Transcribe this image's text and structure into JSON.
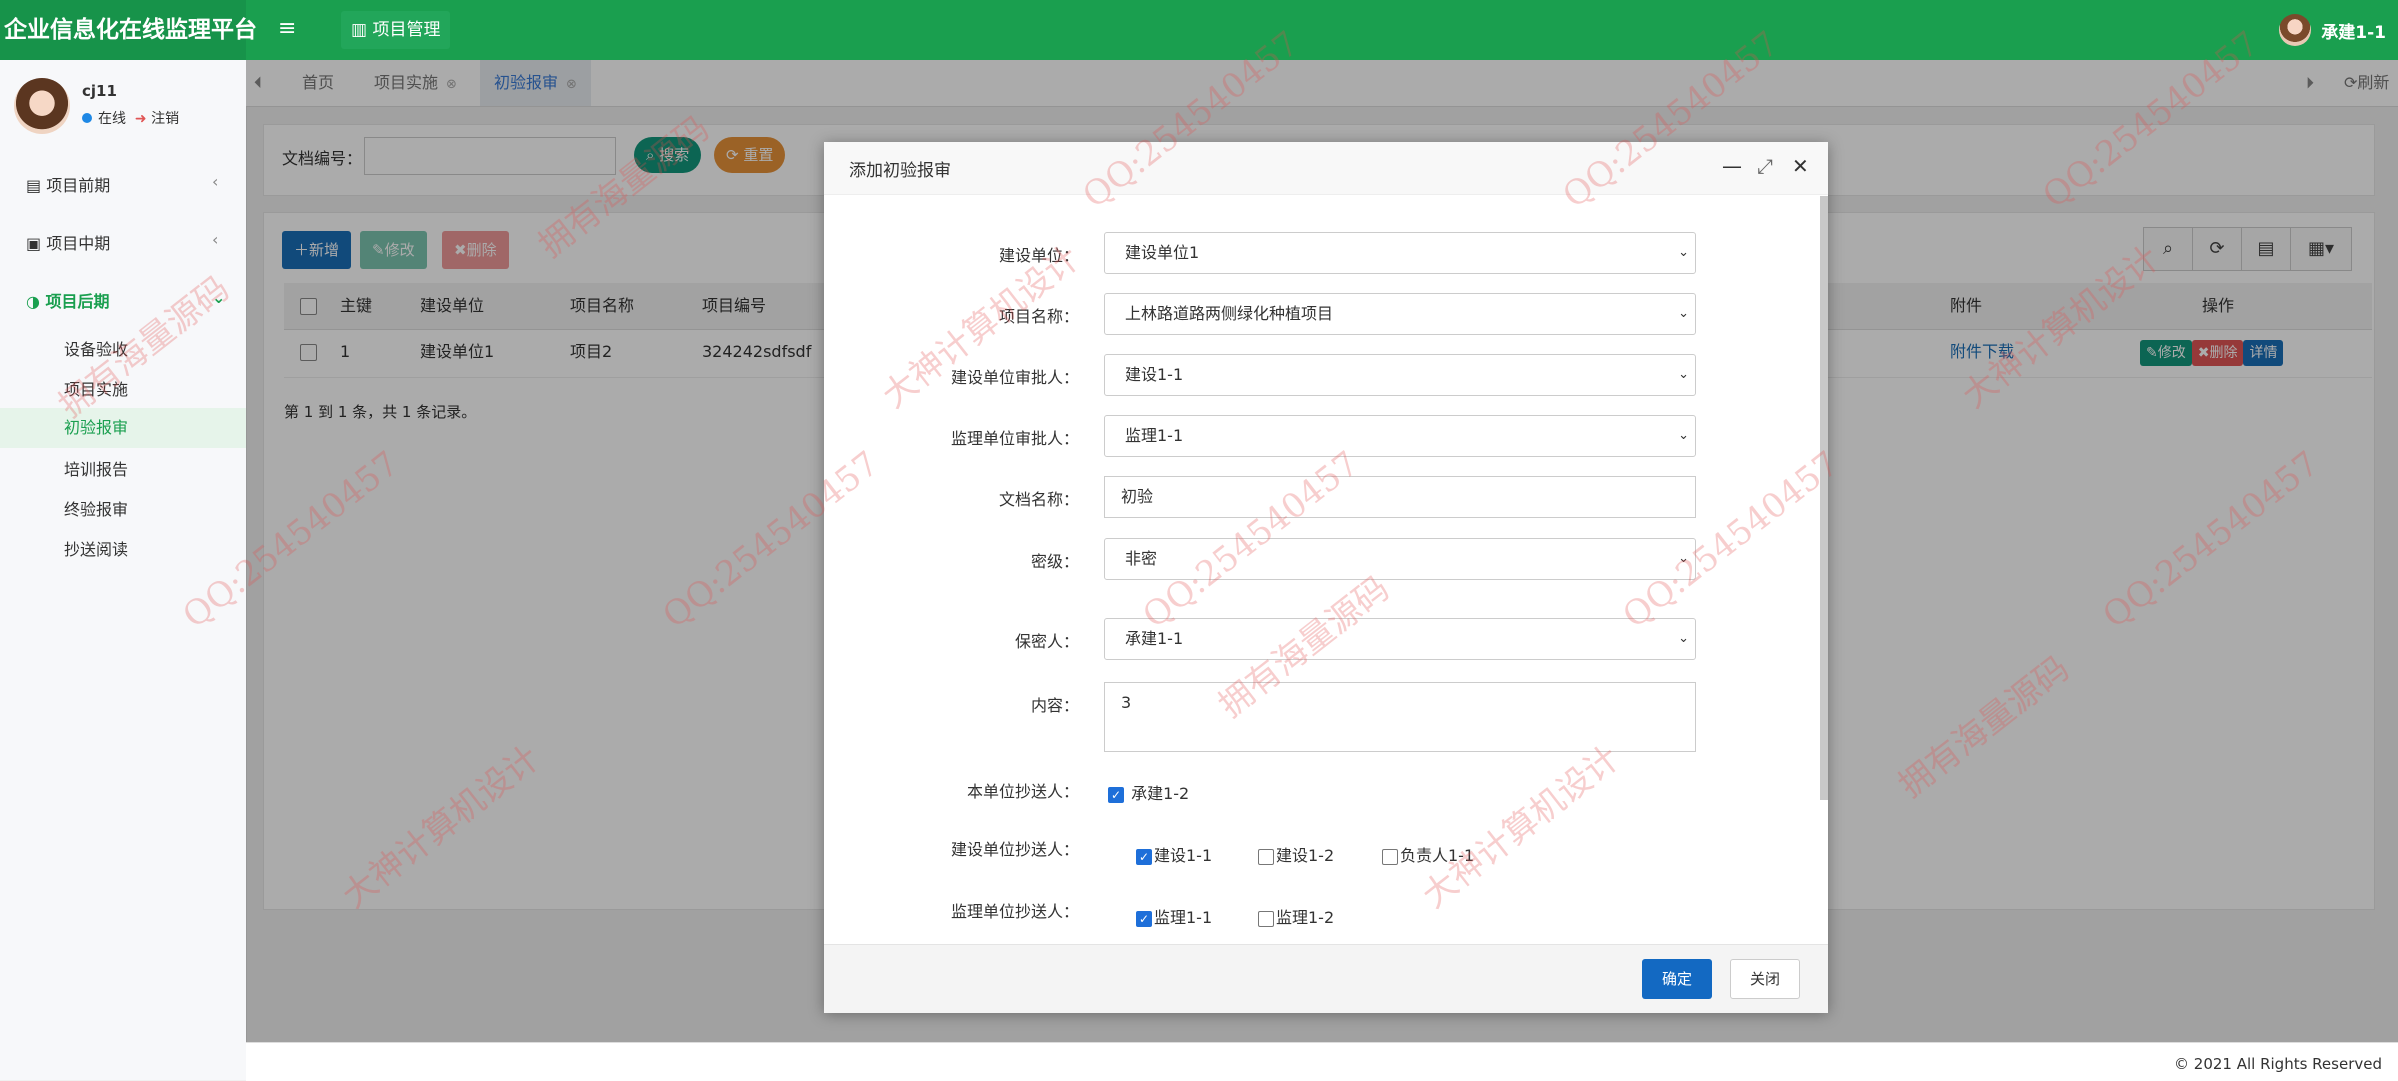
{
  "app": {
    "title": "企业信息化在线监理平台",
    "module_button": "项目管理",
    "user_top": "承建1-1"
  },
  "sidebar": {
    "user_name": "cj11",
    "status_online": "在线",
    "logout": "注销",
    "sections": [
      {
        "label": "项目前期"
      },
      {
        "label": "项目中期"
      },
      {
        "label": "项目后期"
      }
    ],
    "sub_items": [
      "设备验收",
      "项目实施",
      "初验报审",
      "培训报告",
      "终验报审",
      "抄送阅读"
    ]
  },
  "tabs": [
    {
      "label": "首页"
    },
    {
      "label": "项目实施"
    },
    {
      "label": "初验报审"
    }
  ],
  "tabs_right": {
    "refresh": "刷新"
  },
  "search": {
    "label": "文档编号：",
    "search_button": "搜索",
    "reset_button": "重置"
  },
  "toolbar": {
    "add": "新增",
    "edit": "修改",
    "delete": "删除"
  },
  "table": {
    "headers": [
      "主键",
      "建设单位",
      "项目名称",
      "项目编号",
      "附件",
      "操作"
    ],
    "rows": [
      {
        "id": "1",
        "unit": "建设单位1",
        "project": "项目2",
        "code": "324242sdfsdf",
        "attachment": "附件下载",
        "ops": [
          "修改",
          "删除",
          "详情"
        ]
      }
    ],
    "pager": "第 1 到 1 条，共 1 条记录。"
  },
  "footer": "© 2021 All Rights Reserved",
  "modal": {
    "title": "添加初验报审",
    "fields": [
      {
        "label": "建设单位：",
        "value": "建设单位1"
      },
      {
        "label": "项目名称：",
        "value": "上林路道路两侧绿化种植项目"
      },
      {
        "label": "建设单位审批人：",
        "value": "建设1-1"
      },
      {
        "label": "监理单位审批人：",
        "value": "监理1-1"
      },
      {
        "label": "文档名称：",
        "value": "初验"
      },
      {
        "label": "密级：",
        "value": "非密"
      },
      {
        "label": "保密人：",
        "value": "承建1-1"
      },
      {
        "label": "内容：",
        "value": "3"
      }
    ],
    "cc_self_label": "本单位抄送人：",
    "cc_self_options": [
      {
        "label": "承建1-2",
        "checked": true
      }
    ],
    "cc_build_label": "建设单位抄送人：",
    "cc_build_options": [
      {
        "label": "建设1-1",
        "checked": true
      },
      {
        "label": "建设1-2",
        "checked": false
      },
      {
        "label": "负责人1-1",
        "checked": false
      }
    ],
    "cc_sup_label": "监理单位抄送人：",
    "cc_sup_options": [
      {
        "label": "监理1-1",
        "checked": true
      },
      {
        "label": "监理1-2",
        "checked": false
      }
    ],
    "ok_button": "确定",
    "close_button": "关闭"
  },
  "watermarks": [
    "QQ:254540457",
    "大神计算机设计",
    "拥有海量源码"
  ],
  "colors": {
    "brand_green": "#1a9f4f",
    "primary_blue": "#1369c2",
    "danger_red": "#e05555",
    "reset_orange": "#e8923a"
  }
}
